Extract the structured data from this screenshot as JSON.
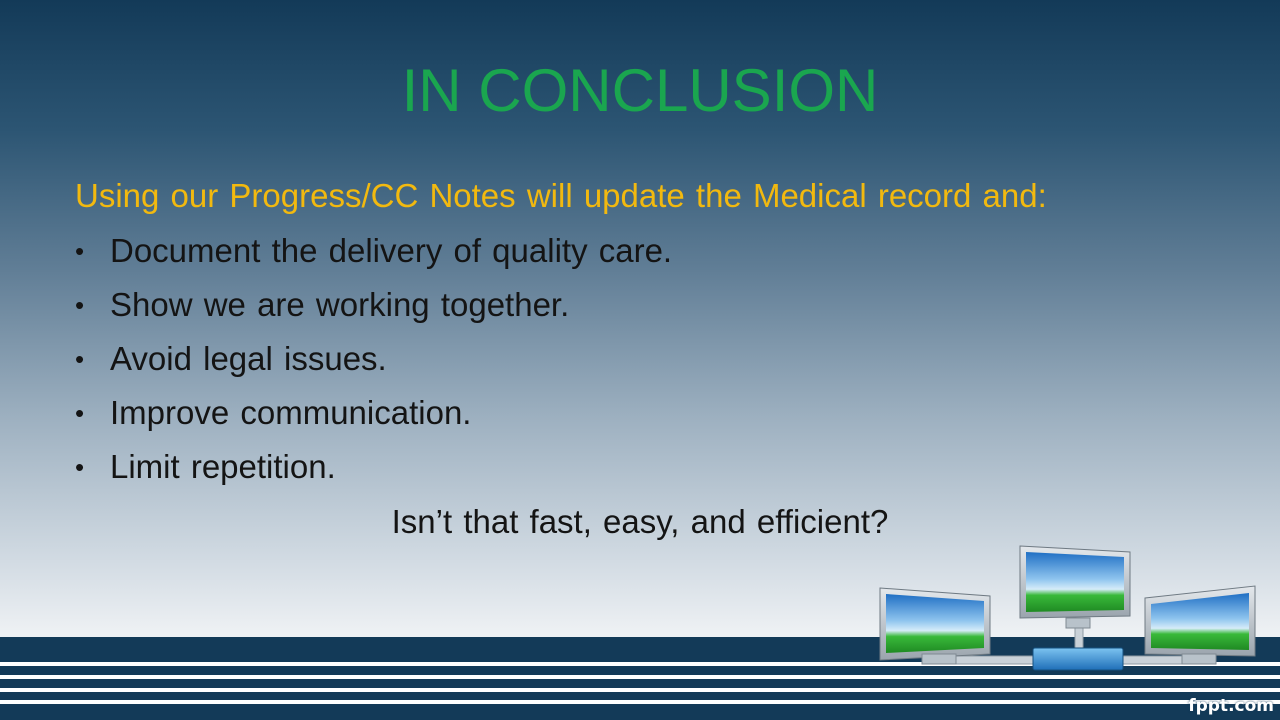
{
  "slide": {
    "title": "IN CONCLUSION",
    "intro": "Using our Progress/CC Notes will update the Medical record and:",
    "bullet_symbol": "•",
    "bullets": [
      "Document the delivery of quality care.",
      "Show we are working together.",
      "Avoid legal issues.",
      "Improve communication.",
      "Limit repetition."
    ],
    "closing": "Isn’t that fast, easy, and efficient?",
    "watermark": "fppt.com"
  },
  "colors": {
    "title": "#1aa64f",
    "intro": "#f2b90f",
    "body_text": "#141414",
    "footer_band": "#133a58"
  },
  "icons": [
    "network-monitors-illustration",
    "monitor-icon"
  ]
}
